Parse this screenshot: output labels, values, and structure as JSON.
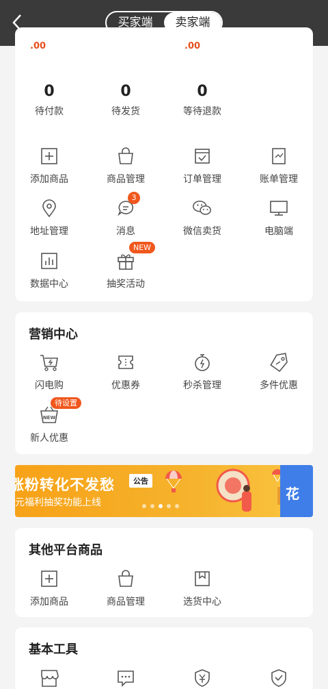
{
  "header": {
    "segment": {
      "buyer_label": "买家端",
      "seller_label": "卖家端",
      "active": "seller"
    }
  },
  "order_stats": [
    {
      "value": "0",
      "label": "待付款"
    },
    {
      "value": "0",
      "label": "待发货"
    },
    {
      "value": "0",
      "label": "等待退款"
    }
  ],
  "partial_amounts": [
    ".00",
    ".00"
  ],
  "tools": [
    {
      "label": "添加商品",
      "icon": "plus-square-icon"
    },
    {
      "label": "商品管理",
      "icon": "bag-icon"
    },
    {
      "label": "订单管理",
      "icon": "calendar-check-icon"
    },
    {
      "label": "账单管理",
      "icon": "bill-chart-icon"
    },
    {
      "label": "地址管理",
      "icon": "location-pin-icon"
    },
    {
      "label": "消息",
      "icon": "chat-bubble-icon",
      "badge": "3"
    },
    {
      "label": "微信卖货",
      "icon": "wechat-icon"
    },
    {
      "label": "电脑端",
      "icon": "monitor-icon"
    },
    {
      "label": "数据中心",
      "icon": "bar-chart-icon"
    },
    {
      "label": "抽奖活动",
      "icon": "gift-icon",
      "badge": "NEW"
    }
  ],
  "marketing": {
    "title": "营销中心",
    "items": [
      {
        "label": "闪电购",
        "icon": "flash-cart-icon"
      },
      {
        "label": "优惠券",
        "icon": "coupon-icon"
      },
      {
        "label": "秒杀管理",
        "icon": "stopwatch-icon"
      },
      {
        "label": "多件优惠",
        "icon": "price-tag-icon"
      },
      {
        "label": "新人优惠",
        "icon": "new-basket-icon",
        "badge": "待设置"
      }
    ]
  },
  "banner": {
    "line1": "涨粉转化不发愁",
    "line2": "元福利抽奖功能上线",
    "tag": "公告",
    "right_text": "花",
    "active_dot": 2
  },
  "other_platform": {
    "title": "其他平台商品",
    "items": [
      {
        "label": "添加商品",
        "icon": "plus-square-icon"
      },
      {
        "label": "商品管理",
        "icon": "bag-icon"
      },
      {
        "label": "选货中心",
        "icon": "bookmark-box-icon"
      }
    ]
  },
  "basic_tools": {
    "title": "基本工具",
    "items": [
      {
        "icon": "shop-icon"
      },
      {
        "icon": "message-dots-icon"
      },
      {
        "icon": "yuan-shield-icon"
      },
      {
        "icon": "check-shield-icon"
      }
    ]
  },
  "colors": {
    "accent": "#f0571c",
    "header_bg": "#3a3a3a",
    "banner": "#f7a218"
  }
}
